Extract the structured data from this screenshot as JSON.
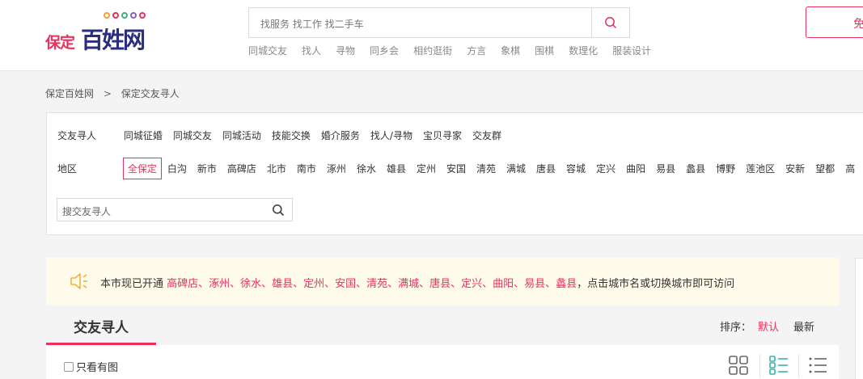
{
  "header": {
    "logo_prefix": "保定",
    "logo_main": "百姓网",
    "logo_dot_colors": [
      "#f2a23c",
      "#e8315c",
      "#3cb371",
      "#8a5cc7",
      "#e8315c"
    ],
    "search_placeholder": "找服务 找工作 找二手车",
    "hot_links": [
      "同城交友",
      "找人",
      "寻物",
      "同乡会",
      "相约逛街",
      "方言",
      "象棋",
      "围棋",
      "数理化",
      "服装设计"
    ],
    "publish_label": "免"
  },
  "breadcrumb": {
    "items": [
      "保定百姓网",
      "保定交友寻人"
    ]
  },
  "filter": {
    "category_label": "交友寻人",
    "categories": [
      "同城征婚",
      "同城交友",
      "同城活动",
      "技能交换",
      "婚介服务",
      "找人/寻物",
      "宝贝寻家",
      "交友群"
    ],
    "region_label": "地区",
    "regions": [
      "全保定",
      "白沟",
      "新市",
      "高碑店",
      "北市",
      "南市",
      "涿州",
      "徐水",
      "雄县",
      "定州",
      "安国",
      "清苑",
      "满城",
      "唐县",
      "容城",
      "定兴",
      "曲阳",
      "易县",
      "蠡县",
      "博野",
      "莲池区",
      "安新",
      "望都",
      "高"
    ],
    "selected_region": "全保定",
    "search_placeholder": "搜交友寻人"
  },
  "notice": {
    "prefix": "本市现已开通",
    "cities": "高碑店、涿州、徐水、雄县、定州、安国、清苑、满城、唐县、定兴、曲阳、易县、蠡县",
    "suffix": "，点击城市名或切换城市即可访问"
  },
  "list": {
    "tab_title": "交友寻人",
    "sort_label": "排序：",
    "sort_default": "默认",
    "sort_latest": "最新",
    "only_images_label": "只看有图"
  },
  "colors": {
    "accent": "#e8315c",
    "logo_blue": "#2a2f7d",
    "notice_bg": "#fffbeb",
    "teal": "#3bb5a8"
  }
}
